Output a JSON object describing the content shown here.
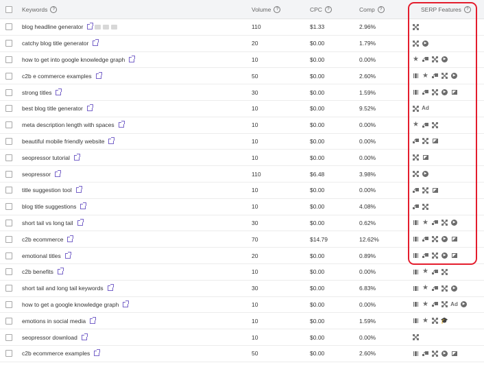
{
  "header": {
    "keywords": "Keywords",
    "volume": "Volume",
    "cpc": "CPC",
    "comp": "Comp",
    "serp": "SERP Features",
    "help": "?"
  },
  "highlight_color": "#e41c2c",
  "rows": [
    {
      "keyword": "blog headline generator",
      "volume": "110",
      "cpc": "$1.33",
      "comp": "2.96%",
      "tags": 3,
      "serp": [
        "link"
      ]
    },
    {
      "keyword": "catchy blog title generator",
      "volume": "20",
      "cpc": "$0.00",
      "comp": "1.79%",
      "serp": [
        "link",
        "video"
      ]
    },
    {
      "keyword": "how to get into google knowledge graph",
      "volume": "10",
      "cpc": "$0.00",
      "comp": "0.00%",
      "serp": [
        "star",
        "sitelinks",
        "link",
        "video"
      ]
    },
    {
      "keyword": "c2b e commerce examples",
      "volume": "50",
      "cpc": "$0.00",
      "comp": "2.60%",
      "serp": [
        "carousel",
        "star",
        "sitelinks",
        "link",
        "video"
      ]
    },
    {
      "keyword": "strong titles",
      "volume": "30",
      "cpc": "$0.00",
      "comp": "1.59%",
      "serp": [
        "carousel",
        "sitelinks",
        "link",
        "video",
        "image"
      ]
    },
    {
      "keyword": "best blog title generator",
      "volume": "10",
      "cpc": "$0.00",
      "comp": "9.52%",
      "serp": [
        "link",
        "ad"
      ]
    },
    {
      "keyword": "meta description length with spaces",
      "volume": "10",
      "cpc": "$0.00",
      "comp": "0.00%",
      "serp": [
        "star",
        "sitelinks",
        "link"
      ]
    },
    {
      "keyword": "beautiful mobile friendly website",
      "volume": "10",
      "cpc": "$0.00",
      "comp": "0.00%",
      "serp": [
        "sitelinks",
        "link",
        "image"
      ]
    },
    {
      "keyword": "seopressor tutorial",
      "volume": "10",
      "cpc": "$0.00",
      "comp": "0.00%",
      "serp": [
        "link",
        "image"
      ]
    },
    {
      "keyword": "seopressor",
      "volume": "110",
      "cpc": "$6.48",
      "comp": "3.98%",
      "serp": [
        "link",
        "video"
      ]
    },
    {
      "keyword": "title suggestion tool",
      "volume": "10",
      "cpc": "$0.00",
      "comp": "0.00%",
      "serp": [
        "sitelinks",
        "link",
        "image"
      ]
    },
    {
      "keyword": "blog title suggestions",
      "volume": "10",
      "cpc": "$0.00",
      "comp": "4.08%",
      "serp": [
        "sitelinks",
        "link"
      ]
    },
    {
      "keyword": "short tail vs long tail",
      "volume": "30",
      "cpc": "$0.00",
      "comp": "0.62%",
      "serp": [
        "carousel",
        "star",
        "sitelinks",
        "link",
        "video"
      ]
    },
    {
      "keyword": "c2b ecommerce",
      "volume": "70",
      "cpc": "$14.79",
      "comp": "12.62%",
      "serp": [
        "carousel",
        "sitelinks",
        "link",
        "video",
        "image"
      ]
    },
    {
      "keyword": "emotional titles",
      "volume": "20",
      "cpc": "$0.00",
      "comp": "0.89%",
      "serp": [
        "carousel",
        "sitelinks",
        "link",
        "video",
        "image"
      ]
    },
    {
      "keyword": "c2b benefits",
      "volume": "10",
      "cpc": "$0.00",
      "comp": "0.00%",
      "serp": [
        "carousel",
        "star",
        "sitelinks",
        "link"
      ]
    },
    {
      "keyword": "short tail and long tail keywords",
      "volume": "30",
      "cpc": "$0.00",
      "comp": "6.83%",
      "serp": [
        "carousel",
        "star",
        "sitelinks",
        "link",
        "video"
      ]
    },
    {
      "keyword": "how to get a google knowledge graph",
      "volume": "10",
      "cpc": "$0.00",
      "comp": "0.00%",
      "serp": [
        "carousel",
        "star",
        "sitelinks",
        "link",
        "ad",
        "video"
      ]
    },
    {
      "keyword": "emotions in social media",
      "volume": "10",
      "cpc": "$0.00",
      "comp": "1.59%",
      "serp": [
        "carousel",
        "star",
        "link",
        "education"
      ]
    },
    {
      "keyword": "seopressor download",
      "volume": "10",
      "cpc": "$0.00",
      "comp": "0.00%",
      "serp": [
        "link"
      ]
    },
    {
      "keyword": "c2b ecommerce examples",
      "volume": "50",
      "cpc": "$0.00",
      "comp": "2.60%",
      "serp": [
        "carousel",
        "sitelinks",
        "link",
        "video",
        "image"
      ]
    }
  ]
}
